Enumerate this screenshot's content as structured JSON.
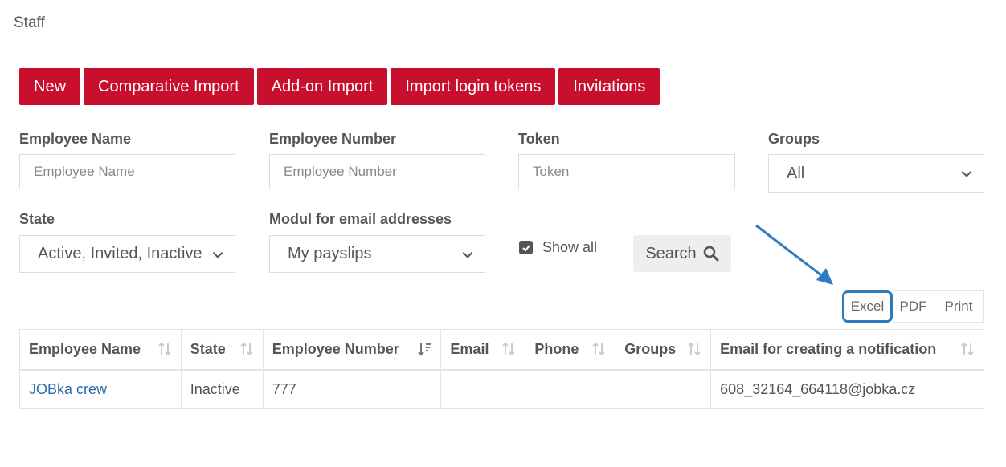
{
  "header": {
    "title": "Staff"
  },
  "toolbar": {
    "new": "New",
    "comparative_import": "Comparative Import",
    "addon_import": "Add-on Import",
    "import_login_tokens": "Import login tokens",
    "invitations": "Invitations"
  },
  "filters": {
    "employee_name": {
      "label": "Employee Name",
      "placeholder": "Employee Name"
    },
    "employee_number": {
      "label": "Employee Number",
      "placeholder": "Employee Number"
    },
    "token": {
      "label": "Token",
      "placeholder": "Token"
    },
    "groups": {
      "label": "Groups",
      "value": "All"
    },
    "state": {
      "label": "State",
      "value": "Active, Invited, Inactive"
    },
    "modul": {
      "label": "Modul for email addresses",
      "value": "My payslips"
    },
    "show_all": {
      "label": "Show all",
      "checked": true
    },
    "search": {
      "label": "Search"
    }
  },
  "export": {
    "excel": "Excel",
    "pdf": "PDF",
    "print": "Print"
  },
  "colors": {
    "primary": "#c8102e",
    "highlight": "#2e7bbf",
    "link": "#2b6cb0"
  },
  "table": {
    "columns": [
      "Employee Name",
      "State",
      "Employee Number",
      "Email",
      "Phone",
      "Groups",
      "Email for creating a notification"
    ],
    "rows": [
      [
        "JOBka crew",
        "Inactive",
        "777",
        "",
        "",
        "",
        "608_32164_664118@jobka.cz"
      ]
    ]
  }
}
